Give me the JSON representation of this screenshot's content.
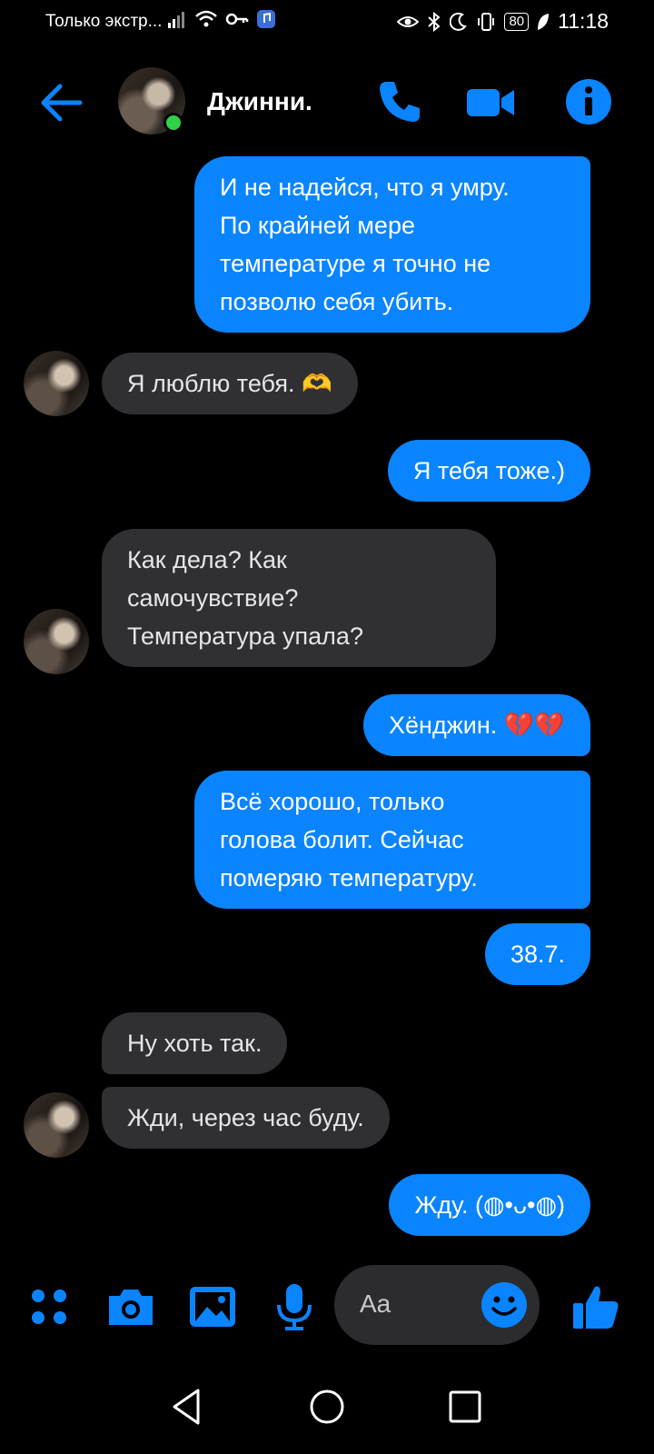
{
  "status_bar": {
    "carrier": "Только экстр...",
    "battery": "80",
    "time": "11:18"
  },
  "header": {
    "contact_name": "Джинни."
  },
  "messages": [
    {
      "side": "out",
      "text": "И не надейся, что я умру.\nПо крайней мере\nтемпературе я точно не\nпозволю себя убить."
    },
    {
      "side": "in",
      "text": "Я люблю тебя. 🫶"
    },
    {
      "side": "out",
      "text": "Я тебя тоже.)"
    },
    {
      "side": "in",
      "text": "Как дела? Как\nсамочувствие?\nТемпература упала?"
    },
    {
      "side": "out",
      "text": "Хёнджин. 💔💔"
    },
    {
      "side": "out",
      "text": "Всё хорошо, только\nголова болит. Сейчас\nпомеряю температуру."
    },
    {
      "side": "out",
      "text": "38.7."
    },
    {
      "side": "in",
      "text": "Ну хоть так."
    },
    {
      "side": "in",
      "text": "Жди, через час буду."
    },
    {
      "side": "out",
      "text": "Жду. (◍•ᴗ•◍)"
    }
  ],
  "composer": {
    "placeholder": "Aa"
  },
  "colors": {
    "accent": "#0a84ff",
    "incoming_bubble": "#303032",
    "background": "#000000",
    "online": "#31d04a"
  },
  "icons": {
    "header": [
      "back-arrow-icon",
      "phone-icon",
      "video-camera-icon",
      "info-icon"
    ],
    "composer": [
      "menu-dots-icon",
      "camera-icon",
      "gallery-icon",
      "microphone-icon",
      "emoji-icon",
      "thumbs-up-icon"
    ],
    "navigation": [
      "nav-back-icon",
      "nav-home-icon",
      "nav-recents-icon"
    ]
  }
}
